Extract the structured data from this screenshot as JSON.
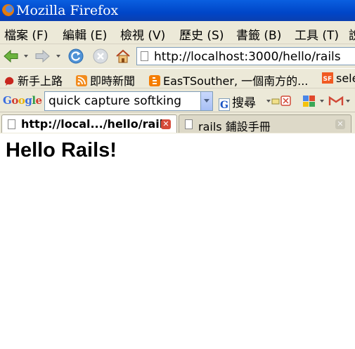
{
  "window": {
    "title": "Mozilla Firefox"
  },
  "menu": [
    "檔案 (F)",
    "編輯 (E)",
    "檢視 (V)",
    "歷史 (S)",
    "書籤 (B)",
    "工具 (T)",
    "說"
  ],
  "nav": {
    "url": "http://localhost:3000/hello/rails"
  },
  "bookmarks": [
    "新手上路",
    "即時新聞",
    "EasTSouther, 一個南方的...",
    "sele"
  ],
  "google_toolbar": {
    "logo": "Google",
    "search_value": "quick capture softking",
    "search_button": "搜尋"
  },
  "tabs": [
    {
      "label": "http://local.../hello/rails",
      "active": true
    },
    {
      "label": "rails 鋪設手冊",
      "active": false
    }
  ],
  "page": {
    "heading": "Hello Rails!"
  },
  "colors": {
    "titlebar": "#0a5fe0",
    "chrome": "#ece9d8",
    "tab_close": "#d64b3a"
  },
  "icons": [
    "firefox-logo-icon",
    "back-icon",
    "forward-icon",
    "reload-icon",
    "stop-icon",
    "home-icon",
    "page-icon",
    "gmail-icon"
  ]
}
